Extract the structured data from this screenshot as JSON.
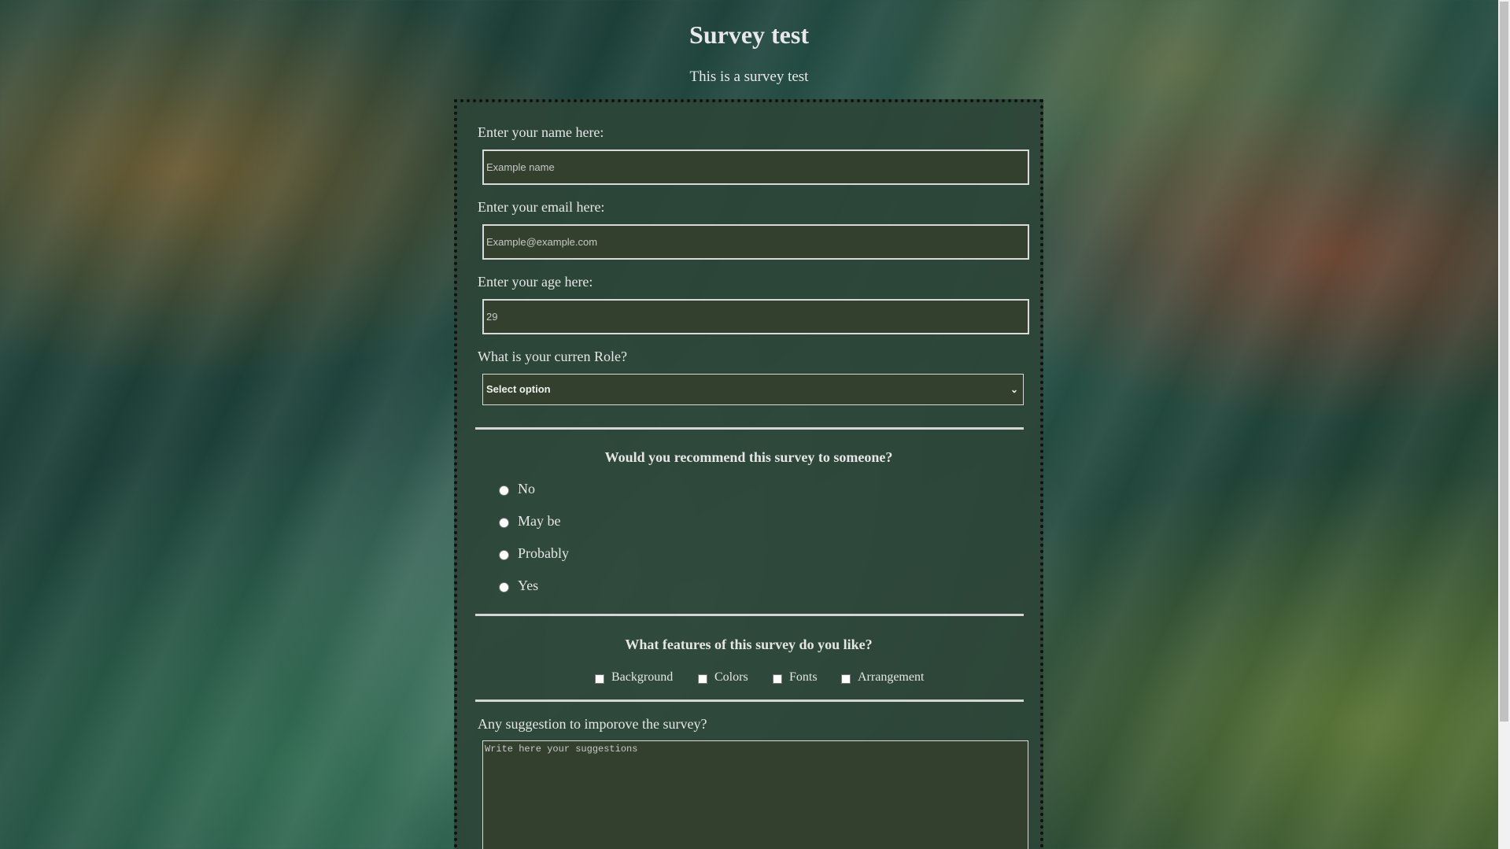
{
  "page": {
    "title": "Survey test",
    "description": "This is a survey test"
  },
  "form": {
    "name": {
      "label": "Enter your name here:",
      "placeholder": "Example name"
    },
    "email": {
      "label": "Enter your email here:",
      "placeholder": "Example@example.com"
    },
    "age": {
      "label": "Enter your age here:",
      "placeholder": "29"
    },
    "role": {
      "label": "What is your curren Role?",
      "selected": "Select option"
    },
    "recommend": {
      "question": "Would you recommend this survey to someone?",
      "options": [
        "No",
        "May be",
        "Probably",
        "Yes"
      ]
    },
    "features": {
      "question": "What features of this survey do you like?",
      "options": [
        "Background",
        "Colors",
        "Fonts",
        "Arrangement"
      ]
    },
    "suggestions": {
      "label": "Any suggestion to imporove the survey?",
      "placeholder": "Write here your suggestions"
    }
  },
  "icons": {
    "select_chevron": "chevron-down-icon"
  }
}
